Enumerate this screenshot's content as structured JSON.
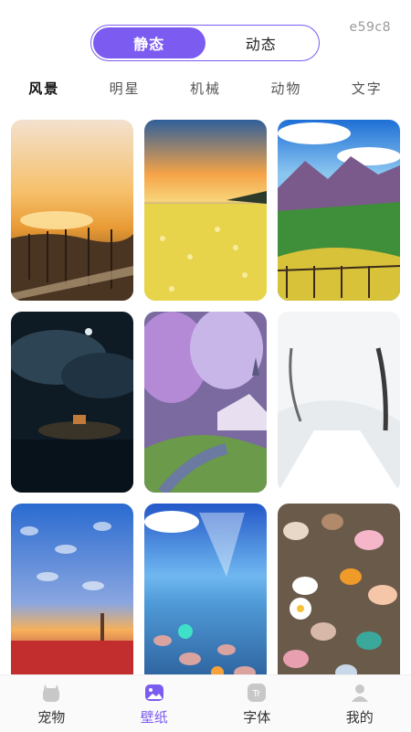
{
  "header": {
    "tabs": [
      {
        "label": "静态",
        "active": true
      },
      {
        "label": "动态",
        "active": false
      }
    ],
    "code": "e59c8"
  },
  "categories": [
    {
      "label": "风景",
      "active": true
    },
    {
      "label": "明星",
      "active": false
    },
    {
      "label": "机械",
      "active": false
    },
    {
      "label": "动物",
      "active": false
    },
    {
      "label": "文字",
      "active": false
    }
  ],
  "wallpapers": [
    {
      "name": "sunset-tree-avenue"
    },
    {
      "name": "flower-field-sunset"
    },
    {
      "name": "mountain-valley-road"
    },
    {
      "name": "moonlit-island-house"
    },
    {
      "name": "forest-church-stream"
    },
    {
      "name": "snowy-tree-road"
    },
    {
      "name": "cloud-sky-tulips"
    },
    {
      "name": "ocean-glowing-pebbles"
    },
    {
      "name": "colorful-pebbles"
    }
  ],
  "bottom_nav": [
    {
      "label": "宠物",
      "icon": "pet-icon",
      "active": false
    },
    {
      "label": "壁纸",
      "icon": "wallpaper-icon",
      "active": true
    },
    {
      "label": "字体",
      "icon": "font-icon",
      "active": false
    },
    {
      "label": "我的",
      "icon": "profile-icon",
      "active": false
    }
  ],
  "colors": {
    "accent": "#7c5bf0",
    "inactive_icon": "#c8c8c8"
  }
}
